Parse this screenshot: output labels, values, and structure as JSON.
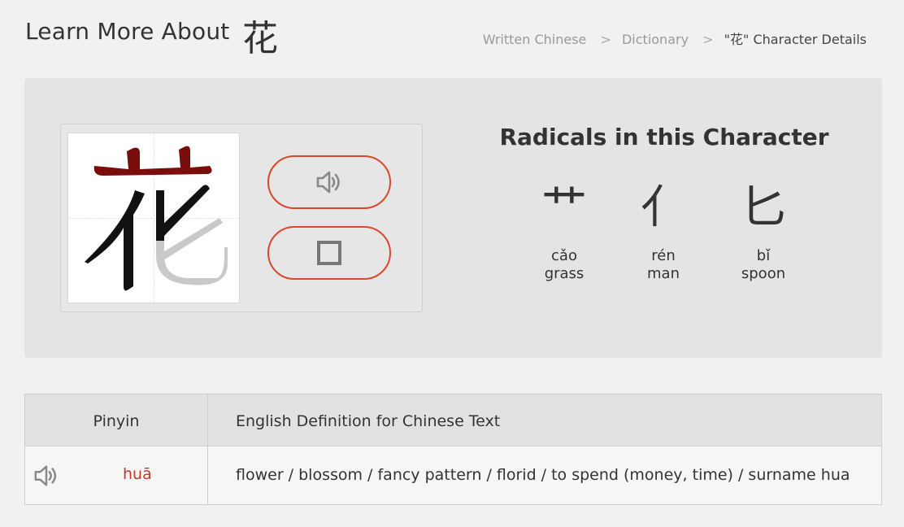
{
  "header": {
    "title": "Learn More About",
    "character": "花",
    "breadcrumb": {
      "items": [
        "Written Chinese",
        "Dictionary"
      ],
      "separator": ">",
      "current": "\"花\" Character Details"
    }
  },
  "character_panel": {
    "character": "花",
    "audio_button_icon": "speaker-icon",
    "stroke_button_icon": "square-icon",
    "accent_color": "#d9482a",
    "radicals_title": "Radicals in this Character",
    "radicals": [
      {
        "glyph": "艹",
        "pinyin": "cǎo",
        "meaning": "grass"
      },
      {
        "glyph": "亻",
        "pinyin": "rén",
        "meaning": "man"
      },
      {
        "glyph": "匕",
        "pinyin": "bǐ",
        "meaning": "spoon"
      }
    ]
  },
  "definition_table": {
    "columns": [
      "Pinyin",
      "English Definition for Chinese Text"
    ],
    "rows": [
      {
        "pinyin": "huā",
        "definition": "flower / blossom / fancy pattern / florid / to spend (money, time) / surname hua"
      }
    ],
    "pinyin_color": "#c0392b"
  }
}
